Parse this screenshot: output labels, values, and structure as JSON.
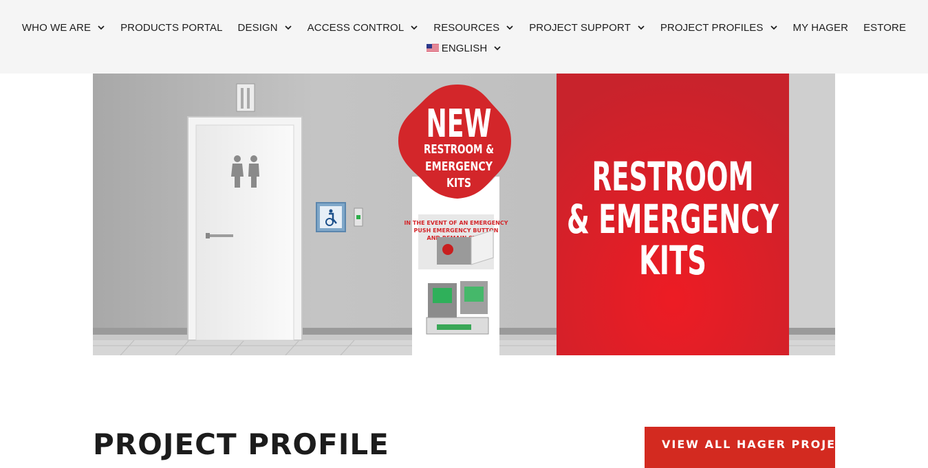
{
  "nav": {
    "items": [
      {
        "label": "WHO WE ARE",
        "dropdown": true
      },
      {
        "label": "PRODUCTS PORTAL",
        "dropdown": false
      },
      {
        "label": "DESIGN",
        "dropdown": true
      },
      {
        "label": "ACCESS CONTROL",
        "dropdown": true
      },
      {
        "label": "RESOURCES",
        "dropdown": true
      },
      {
        "label": "PROJECT SUPPORT",
        "dropdown": true
      },
      {
        "label": "PROJECT PROFILES",
        "dropdown": true
      },
      {
        "label": "MY HAGER",
        "dropdown": false
      },
      {
        "label": "ESTORE",
        "dropdown": false
      }
    ],
    "language": {
      "label": "ENGLISH",
      "flag": "us-flag-icon"
    }
  },
  "banner": {
    "badge_line1": "NEW",
    "badge_line2": "RESTROOM &",
    "badge_line3": "EMERGENCY",
    "badge_line4": "KITS",
    "headline_line1": "RESTROOM",
    "headline_line2": "& EMERGENCY",
    "headline_line3": "KITS",
    "sign_text_line1": "IN THE EVENT OF AN EMERGENCY",
    "sign_text_line2": "PUSH EMERGENCY BUTTON",
    "sign_text_line3": "AND REMAIN STILL",
    "colors": {
      "red": "#d3262a",
      "wall": "#bdbdbd"
    }
  },
  "section": {
    "title": "PROJECT PROFILE",
    "cta_label": "VIEW ALL HAGER PROJECTS"
  }
}
